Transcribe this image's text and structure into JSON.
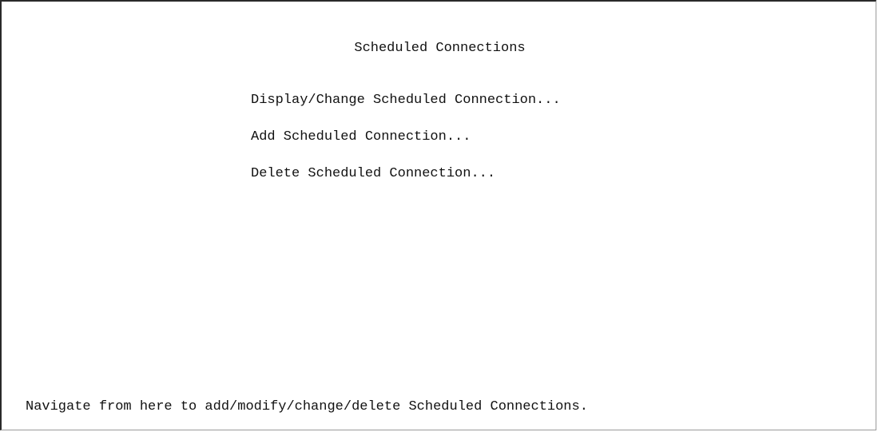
{
  "screen": {
    "title": "Scheduled Connections",
    "menu": [
      {
        "label": "Display/Change Scheduled Connection..."
      },
      {
        "label": "Add Scheduled Connection..."
      },
      {
        "label": "Delete Scheduled Connection..."
      }
    ],
    "help_text": "Navigate from here to add/modify/change/delete Scheduled Connections."
  }
}
